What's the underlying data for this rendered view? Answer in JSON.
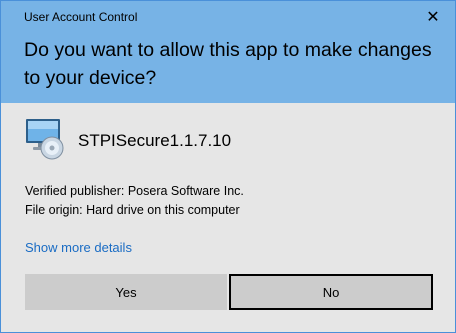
{
  "window": {
    "title": "User Account Control",
    "close_symbol": "✕"
  },
  "prompt": {
    "question": "Do you want to allow this app to make changes to your device?"
  },
  "app": {
    "name": "STPISecure1.1.7.10",
    "icon": "monitor-cd-icon"
  },
  "details": {
    "publisher": "Verified publisher: Posera Software Inc.",
    "origin": "File origin: Hard drive on this computer"
  },
  "links": {
    "show_more": "Show more details"
  },
  "buttons": {
    "yes": "Yes",
    "no": "No"
  },
  "colors": {
    "header": "#77b3e6",
    "body": "#e6e6e6",
    "link": "#1a6cc4",
    "button": "#cccccc"
  }
}
